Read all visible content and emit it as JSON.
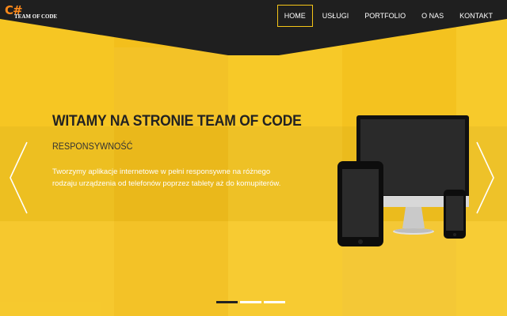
{
  "brand": {
    "mark": "C#",
    "name": "TEAM OF CODE"
  },
  "nav": {
    "items": [
      {
        "label": "HOME",
        "active": true
      },
      {
        "label": "USŁUGI",
        "active": false
      },
      {
        "label": "PORTFOLIO",
        "active": false
      },
      {
        "label": "O NAS",
        "active": false
      },
      {
        "label": "KONTAKT",
        "active": false
      }
    ]
  },
  "slide": {
    "title": "WITAMY NA STRONIE TEAM OF CODE",
    "subtitle": "RESPONSYWNOŚĆ",
    "text": "Tworzymy aplikacje internetowe w pełni responsywne na różnego rodzaju urządzenia od telefonów poprzez tablety aż do komupiterów."
  },
  "carousel": {
    "count": 3,
    "active_index": 0
  },
  "colors": {
    "header_bg": "#1f1f1f",
    "accent": "#f5c518",
    "logo_mark": "#ff8a1a"
  },
  "icons": {
    "prev": "chevron-left-icon",
    "next": "chevron-right-icon"
  }
}
